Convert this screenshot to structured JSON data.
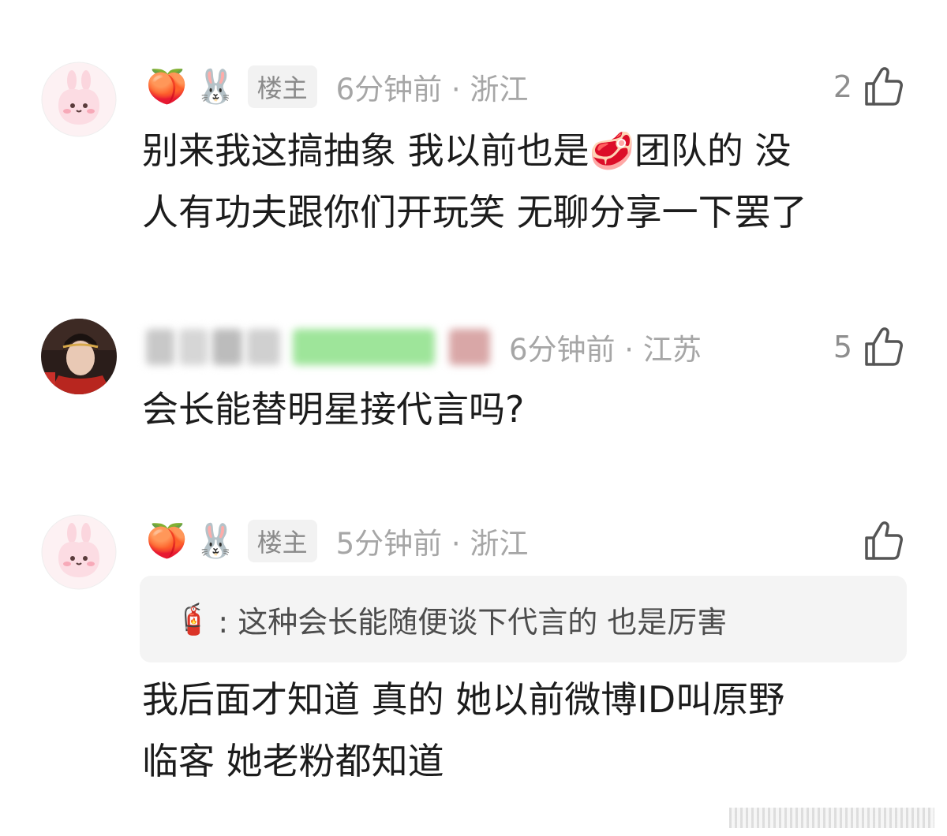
{
  "colors": {
    "host_tag_bg": "#f2f2f2",
    "meta_text": "#a6a6a6",
    "quote_bg": "#f4f4f4"
  },
  "comments": [
    {
      "user_emoji": [
        "🍑",
        "🐰"
      ],
      "host_tag": "楼主",
      "time_location": "6分钟前 · 浙江",
      "likes": "2",
      "text_line1_a": "别来我这搞抽象 我以前也是",
      "text_inline_emoji": "🥩",
      "text_line1_b": "团队的 没",
      "text_line2": "人有功夫跟你们开玩笑 无聊分享一下罢了"
    },
    {
      "time_location": "6分钟前 · 江苏",
      "likes": "5",
      "text": "会长能替明星接代言吗?"
    },
    {
      "user_emoji": [
        "🍑",
        "🐰"
      ],
      "host_tag": "楼主",
      "time_location": "5分钟前 · 浙江",
      "likes": "",
      "quote_icon": "🧯",
      "quote_text": ": 这种会长能随便谈下代言的 也是厉害",
      "text_line1": "我后面才知道 真的 她以前微博ID叫原野",
      "text_line2": "临客 她老粉都知道"
    }
  ]
}
